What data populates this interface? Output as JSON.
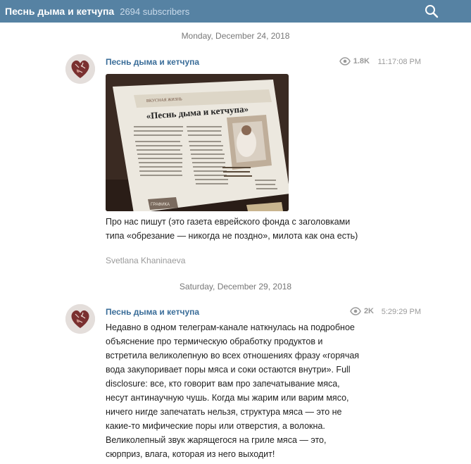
{
  "header": {
    "title": "Песнь дыма и кетчупа",
    "subscribers": "2694 subscribers"
  },
  "dates": {
    "first": "Monday, December 24, 2018",
    "second": "Saturday, December 29, 2018"
  },
  "messages": [
    {
      "author": "Песнь дыма и кетчупа",
      "views": "1.8K",
      "time": "11:17:08 PM",
      "text": "Про нас пишут (это газета еврейского фонда с заголовками типа «обрезание — никогда не поздно», милота как она есть)",
      "signature": "Svetlana Khaninaeva",
      "photo_text": {
        "headline": "«Песнь дыма и кетчупа»",
        "rubric": "ВКУСНАЯ ЖИЗНЬ",
        "corner": "ГРАФИКА"
      }
    },
    {
      "author": "Песнь дыма и кетчупа",
      "views": "2K",
      "time": "5:29:29 PM",
      "lines": [
        "Недавно в одном телеграм-канале наткнулась на подробное",
        "объяснение про термическую обработку продуктов и",
        "встретила великолепную во всех отношениях фразу «горячая",
        "вода закупоривает поры мяса и соки остаются внутри». Full",
        "disclosure: все, кто говорит вам про запечатывание мяса,",
        "несут антинаучную чушь. Когда мы жарим или варим мясо,",
        "ничего нигде запечатать нельзя, структура мяса — это не",
        "какие-то мифические поры или отверстия, а волокна.",
        "Великолепный звук жарящегося на гриле мяса — это,",
        "сюрприз, влага, которая из него выходит!"
      ]
    }
  ],
  "colors": {
    "header_bg": "#5682a3",
    "author": "#3a6d99",
    "meta": "#9a9a9a"
  },
  "icons": {
    "search": "search-icon",
    "views": "eye-icon",
    "avatar": "heart-meat-icon"
  }
}
